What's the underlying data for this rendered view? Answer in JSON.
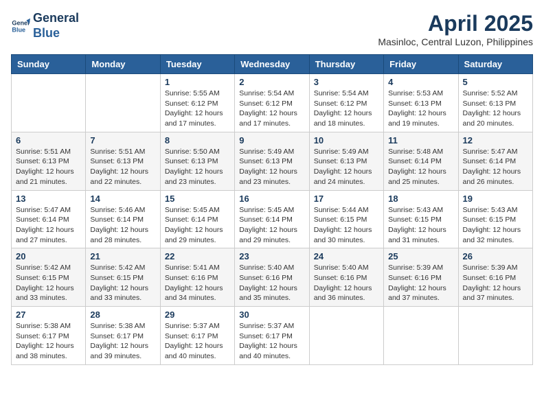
{
  "logo": {
    "line1": "General",
    "line2": "Blue"
  },
  "title": "April 2025",
  "subtitle": "Masinloc, Central Luzon, Philippines",
  "weekdays": [
    "Sunday",
    "Monday",
    "Tuesday",
    "Wednesday",
    "Thursday",
    "Friday",
    "Saturday"
  ],
  "weeks": [
    [
      {
        "day": "",
        "info": ""
      },
      {
        "day": "",
        "info": ""
      },
      {
        "day": "1",
        "info": "Sunrise: 5:55 AM\nSunset: 6:12 PM\nDaylight: 12 hours and 17 minutes."
      },
      {
        "day": "2",
        "info": "Sunrise: 5:54 AM\nSunset: 6:12 PM\nDaylight: 12 hours and 17 minutes."
      },
      {
        "day": "3",
        "info": "Sunrise: 5:54 AM\nSunset: 6:12 PM\nDaylight: 12 hours and 18 minutes."
      },
      {
        "day": "4",
        "info": "Sunrise: 5:53 AM\nSunset: 6:13 PM\nDaylight: 12 hours and 19 minutes."
      },
      {
        "day": "5",
        "info": "Sunrise: 5:52 AM\nSunset: 6:13 PM\nDaylight: 12 hours and 20 minutes."
      }
    ],
    [
      {
        "day": "6",
        "info": "Sunrise: 5:51 AM\nSunset: 6:13 PM\nDaylight: 12 hours and 21 minutes."
      },
      {
        "day": "7",
        "info": "Sunrise: 5:51 AM\nSunset: 6:13 PM\nDaylight: 12 hours and 22 minutes."
      },
      {
        "day": "8",
        "info": "Sunrise: 5:50 AM\nSunset: 6:13 PM\nDaylight: 12 hours and 23 minutes."
      },
      {
        "day": "9",
        "info": "Sunrise: 5:49 AM\nSunset: 6:13 PM\nDaylight: 12 hours and 23 minutes."
      },
      {
        "day": "10",
        "info": "Sunrise: 5:49 AM\nSunset: 6:13 PM\nDaylight: 12 hours and 24 minutes."
      },
      {
        "day": "11",
        "info": "Sunrise: 5:48 AM\nSunset: 6:14 PM\nDaylight: 12 hours and 25 minutes."
      },
      {
        "day": "12",
        "info": "Sunrise: 5:47 AM\nSunset: 6:14 PM\nDaylight: 12 hours and 26 minutes."
      }
    ],
    [
      {
        "day": "13",
        "info": "Sunrise: 5:47 AM\nSunset: 6:14 PM\nDaylight: 12 hours and 27 minutes."
      },
      {
        "day": "14",
        "info": "Sunrise: 5:46 AM\nSunset: 6:14 PM\nDaylight: 12 hours and 28 minutes."
      },
      {
        "day": "15",
        "info": "Sunrise: 5:45 AM\nSunset: 6:14 PM\nDaylight: 12 hours and 29 minutes."
      },
      {
        "day": "16",
        "info": "Sunrise: 5:45 AM\nSunset: 6:14 PM\nDaylight: 12 hours and 29 minutes."
      },
      {
        "day": "17",
        "info": "Sunrise: 5:44 AM\nSunset: 6:15 PM\nDaylight: 12 hours and 30 minutes."
      },
      {
        "day": "18",
        "info": "Sunrise: 5:43 AM\nSunset: 6:15 PM\nDaylight: 12 hours and 31 minutes."
      },
      {
        "day": "19",
        "info": "Sunrise: 5:43 AM\nSunset: 6:15 PM\nDaylight: 12 hours and 32 minutes."
      }
    ],
    [
      {
        "day": "20",
        "info": "Sunrise: 5:42 AM\nSunset: 6:15 PM\nDaylight: 12 hours and 33 minutes."
      },
      {
        "day": "21",
        "info": "Sunrise: 5:42 AM\nSunset: 6:15 PM\nDaylight: 12 hours and 33 minutes."
      },
      {
        "day": "22",
        "info": "Sunrise: 5:41 AM\nSunset: 6:16 PM\nDaylight: 12 hours and 34 minutes."
      },
      {
        "day": "23",
        "info": "Sunrise: 5:40 AM\nSunset: 6:16 PM\nDaylight: 12 hours and 35 minutes."
      },
      {
        "day": "24",
        "info": "Sunrise: 5:40 AM\nSunset: 6:16 PM\nDaylight: 12 hours and 36 minutes."
      },
      {
        "day": "25",
        "info": "Sunrise: 5:39 AM\nSunset: 6:16 PM\nDaylight: 12 hours and 37 minutes."
      },
      {
        "day": "26",
        "info": "Sunrise: 5:39 AM\nSunset: 6:16 PM\nDaylight: 12 hours and 37 minutes."
      }
    ],
    [
      {
        "day": "27",
        "info": "Sunrise: 5:38 AM\nSunset: 6:17 PM\nDaylight: 12 hours and 38 minutes."
      },
      {
        "day": "28",
        "info": "Sunrise: 5:38 AM\nSunset: 6:17 PM\nDaylight: 12 hours and 39 minutes."
      },
      {
        "day": "29",
        "info": "Sunrise: 5:37 AM\nSunset: 6:17 PM\nDaylight: 12 hours and 40 minutes."
      },
      {
        "day": "30",
        "info": "Sunrise: 5:37 AM\nSunset: 6:17 PM\nDaylight: 12 hours and 40 minutes."
      },
      {
        "day": "",
        "info": ""
      },
      {
        "day": "",
        "info": ""
      },
      {
        "day": "",
        "info": ""
      }
    ]
  ]
}
